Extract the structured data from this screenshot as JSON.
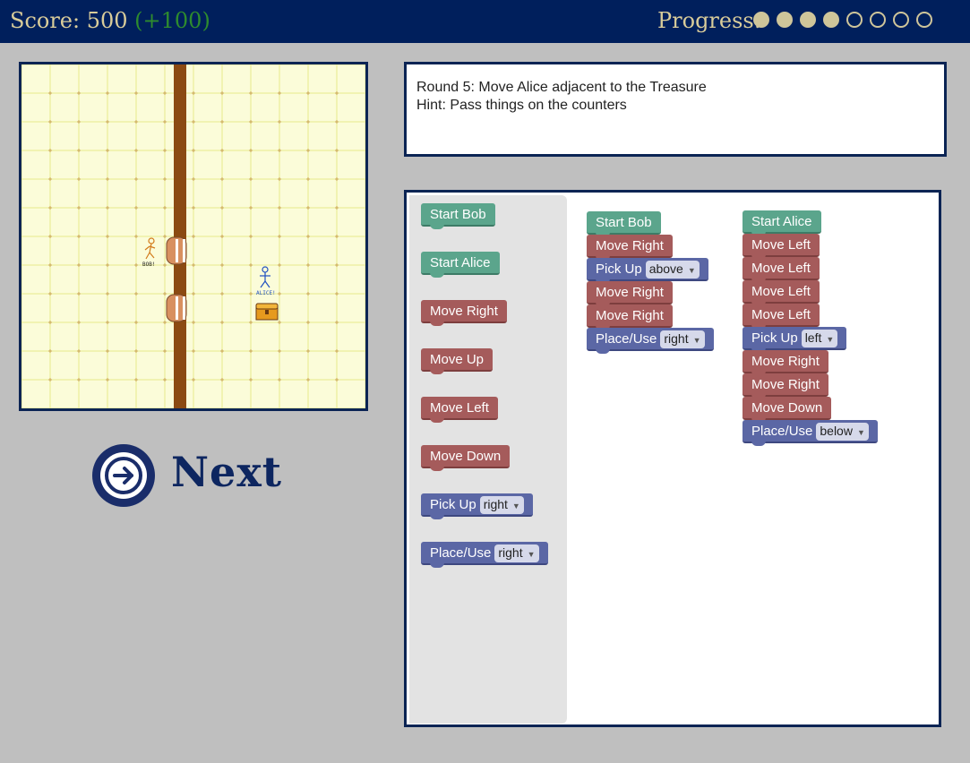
{
  "header": {
    "score_label": "Score: 500",
    "score_bonus": "(+100)",
    "progress_label": "Progress:",
    "progress_total": 8,
    "progress_filled": 4
  },
  "board": {
    "bob_label": "BOB!",
    "alice_label": "ALICE!",
    "treasure": "treasure-chest-icon"
  },
  "next_button": {
    "label": "Next",
    "icon": "arrow-right-circle-icon"
  },
  "info": {
    "line1": "Round 5: Move Alice adjacent to the Treasure",
    "line2": "Hint: Pass things on the counters"
  },
  "toolbox": {
    "start_bob": "Start Bob",
    "start_alice": "Start Alice",
    "move_right": "Move Right",
    "move_up": "Move Up",
    "move_left": "Move Left",
    "move_down": "Move Down",
    "pick_up": "Pick Up",
    "pick_up_dir": "right",
    "place_use": "Place/Use",
    "place_use_dir": "right"
  },
  "program_bob": {
    "start": "Start Bob",
    "steps": [
      "Move Right",
      "Pick Up",
      "Move Right",
      "Move Right",
      "Place/Use"
    ],
    "pick_dir": "above",
    "place_dir": "right"
  },
  "program_alice": {
    "start": "Start Alice",
    "steps": [
      "Move Left",
      "Move Left",
      "Move Left",
      "Move Left",
      "Pick Up",
      "Move Right",
      "Move Right",
      "Move Down",
      "Place/Use"
    ],
    "pick_dir": "left",
    "place_dir": "below"
  },
  "colors": {
    "header_bg": "#001f5c",
    "gold": "#cfc59a",
    "start_block": "#5ba58c",
    "move_block": "#a55b5b",
    "action_block": "#5b67a5"
  }
}
